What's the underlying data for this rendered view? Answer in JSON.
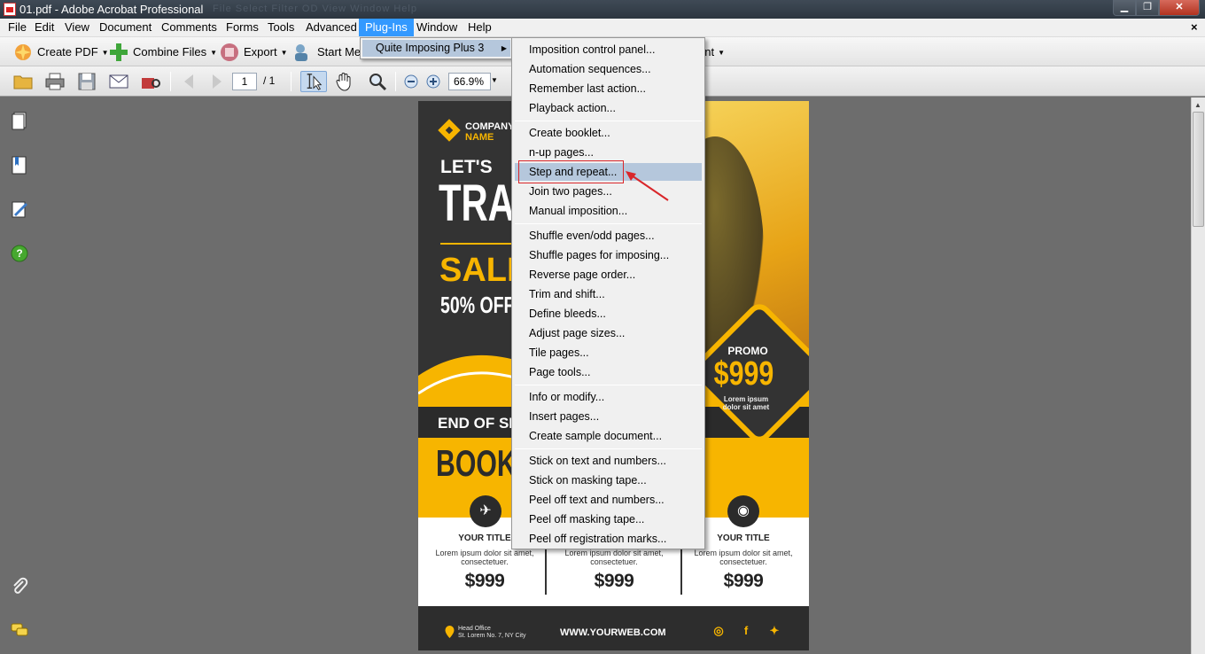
{
  "window": {
    "title": "01.pdf - Adobe Acrobat Professional",
    "ghost_menu": "File   Select   Filter   OD   View   Window   Help",
    "controls": {
      "minimize": "▁",
      "maximize": "❐",
      "close": "✕"
    }
  },
  "menubar": {
    "items": [
      "File",
      "Edit",
      "View",
      "Document",
      "Comments",
      "Forms",
      "Tools",
      "Advanced",
      "Plug-Ins",
      "Window",
      "Help"
    ],
    "active": "Plug-Ins",
    "doc_close": "×"
  },
  "tasks": {
    "create_pdf": "Create PDF",
    "combine_files": "Combine Files",
    "export": "Export",
    "start_meeting": "Start Mee",
    "comment": "nment",
    "caret": "▼"
  },
  "toolbar": {
    "page_current": "1",
    "page_total": "/ 1",
    "zoom": "66.9%",
    "zoom_caret": "▼"
  },
  "plugins_menu": {
    "item": "Quite Imposing Plus 3",
    "arrow": "▶"
  },
  "qi_menu": {
    "groups": [
      [
        "Imposition control panel...",
        "Automation sequences...",
        "Remember last action...",
        "Playback action..."
      ],
      [
        "Create booklet...",
        "n-up pages...",
        "Step and repeat...",
        "Join two pages...",
        "Manual imposition..."
      ],
      [
        "Shuffle even/odd pages...",
        "Shuffle pages for imposing...",
        "Reverse page order...",
        "Trim and shift...",
        "Define bleeds...",
        "Adjust page sizes...",
        "Tile pages...",
        "Page tools..."
      ],
      [
        "Info or modify...",
        "Insert pages...",
        "Create sample document..."
      ],
      [
        "Stick on text and numbers...",
        "Stick on masking tape...",
        "Peel off text and numbers...",
        "Peel off masking tape...",
        "Peel off registration marks..."
      ]
    ],
    "highlighted": "Step and repeat..."
  },
  "flyer": {
    "company": "COMPANY",
    "company2": "NAME",
    "lets": "LET'S",
    "travel": "TRAVEL",
    "sale": "SALE",
    "off": "50% OFF",
    "end_of": "END OF SEASON",
    "book": "BOOK",
    "promo_label": "PROMO",
    "promo_price": "$999",
    "promo_desc1": "Lorem ipsum",
    "promo_desc2": "dolor sit amet",
    "cards": [
      {
        "icon": "✈",
        "title": "YOUR TITLE",
        "desc": "Lorem ipsum dolor sit amet, consectetuer.",
        "price": "$999"
      },
      {
        "icon": "",
        "title": "",
        "desc": "Lorem ipsum dolor sit amet, consectetuer.",
        "price": "$999"
      },
      {
        "icon": "◉",
        "title": "YOUR TITLE",
        "desc": "Lorem ipsum dolor sit amet, consectetuer.",
        "price": "$999"
      }
    ],
    "footer": {
      "address_label": "Head Office",
      "address": "St. Lorem No. 7, NY City",
      "web": "WWW.YOURWEB.COM",
      "social": [
        "◎",
        "f",
        "✦"
      ]
    }
  },
  "colors": {
    "accent_yellow": "#f7b500",
    "dark": "#333333",
    "menu_highlight": "#b5c7dc",
    "menubar_active": "#3399ff",
    "annotation_red": "#d9262a"
  }
}
